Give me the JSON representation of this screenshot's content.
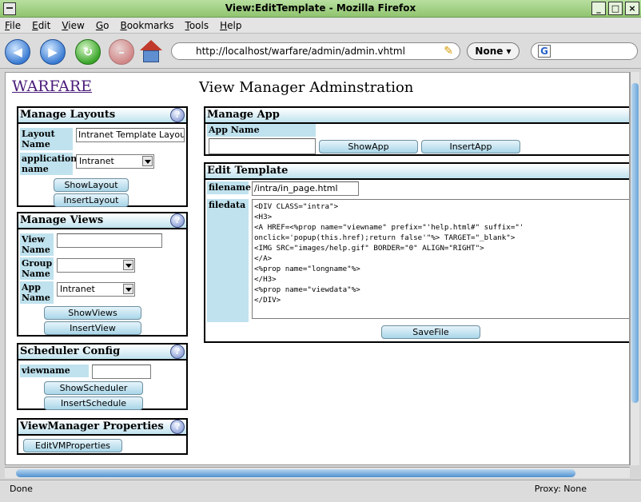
{
  "window": {
    "title": "View:EditTemplate - Mozilla Firefox"
  },
  "menu": {
    "items": [
      "File",
      "Edit",
      "View",
      "Go",
      "Bookmarks",
      "Tools",
      "Help"
    ]
  },
  "toolbar": {
    "url": "http://localhost/warfare/admin/admin.vhtml",
    "none_label": "None",
    "search_value": ""
  },
  "page": {
    "brand": "WARFARE",
    "heading": "View Manager Adminstration"
  },
  "manage_layouts": {
    "title": "Manage Layouts",
    "layout_name_label": "Layout Name",
    "layout_name_value": "Intranet Template Layout",
    "application_name_label": "application name",
    "application_name_value": "Intranet",
    "show_button": "ShowLayout",
    "insert_button": "InsertLayout"
  },
  "manage_views": {
    "title": "Manage Views",
    "view_name_label": "View Name",
    "view_name_value": "",
    "group_name_label": "Group Name",
    "group_name_value": "",
    "app_name_label": "App Name",
    "app_name_value": "Intranet",
    "show_button": "ShowViews",
    "insert_button": "InsertView"
  },
  "scheduler_config": {
    "title": "Scheduler Config",
    "viewname_label": "viewname",
    "viewname_value": "",
    "show_button": "ShowScheduler",
    "insert_button": "InsertSchedule"
  },
  "viewmanager_properties": {
    "title": "ViewManager Properties",
    "edit_button": "EditVMProperties"
  },
  "manage_app": {
    "title": "Manage App",
    "app_name_label": "App Name",
    "app_name_value": "",
    "show_button": "ShowApp",
    "insert_button": "InsertApp"
  },
  "edit_template": {
    "title": "Edit Template",
    "filename_label": "filename",
    "filename_value": "/intra/in_page.html",
    "filedata_label": "filedata",
    "filedata_lines": [
      "<DIV CLASS=\"intra\">",
      "<H3>",
      "<A HREF=<%prop name=\"viewname\" prefix=\"'help.html#\" suffix=\"'",
      "onclick='popup(this.href);return false'\"%> TARGET=\"_blank\">",
      "<IMG SRC=\"images/help.gif\" BORDER=\"0\" ALIGN=\"RIGHT\">",
      "</A>",
      "<%prop name=\"longname\"%>",
      "</H3>",
      "<%prop name=\"viewdata\"%>",
      "</DIV>"
    ],
    "save_button": "SaveFile"
  },
  "status": {
    "left": "Done",
    "right": "Proxy: None"
  },
  "help_glyph": "?"
}
